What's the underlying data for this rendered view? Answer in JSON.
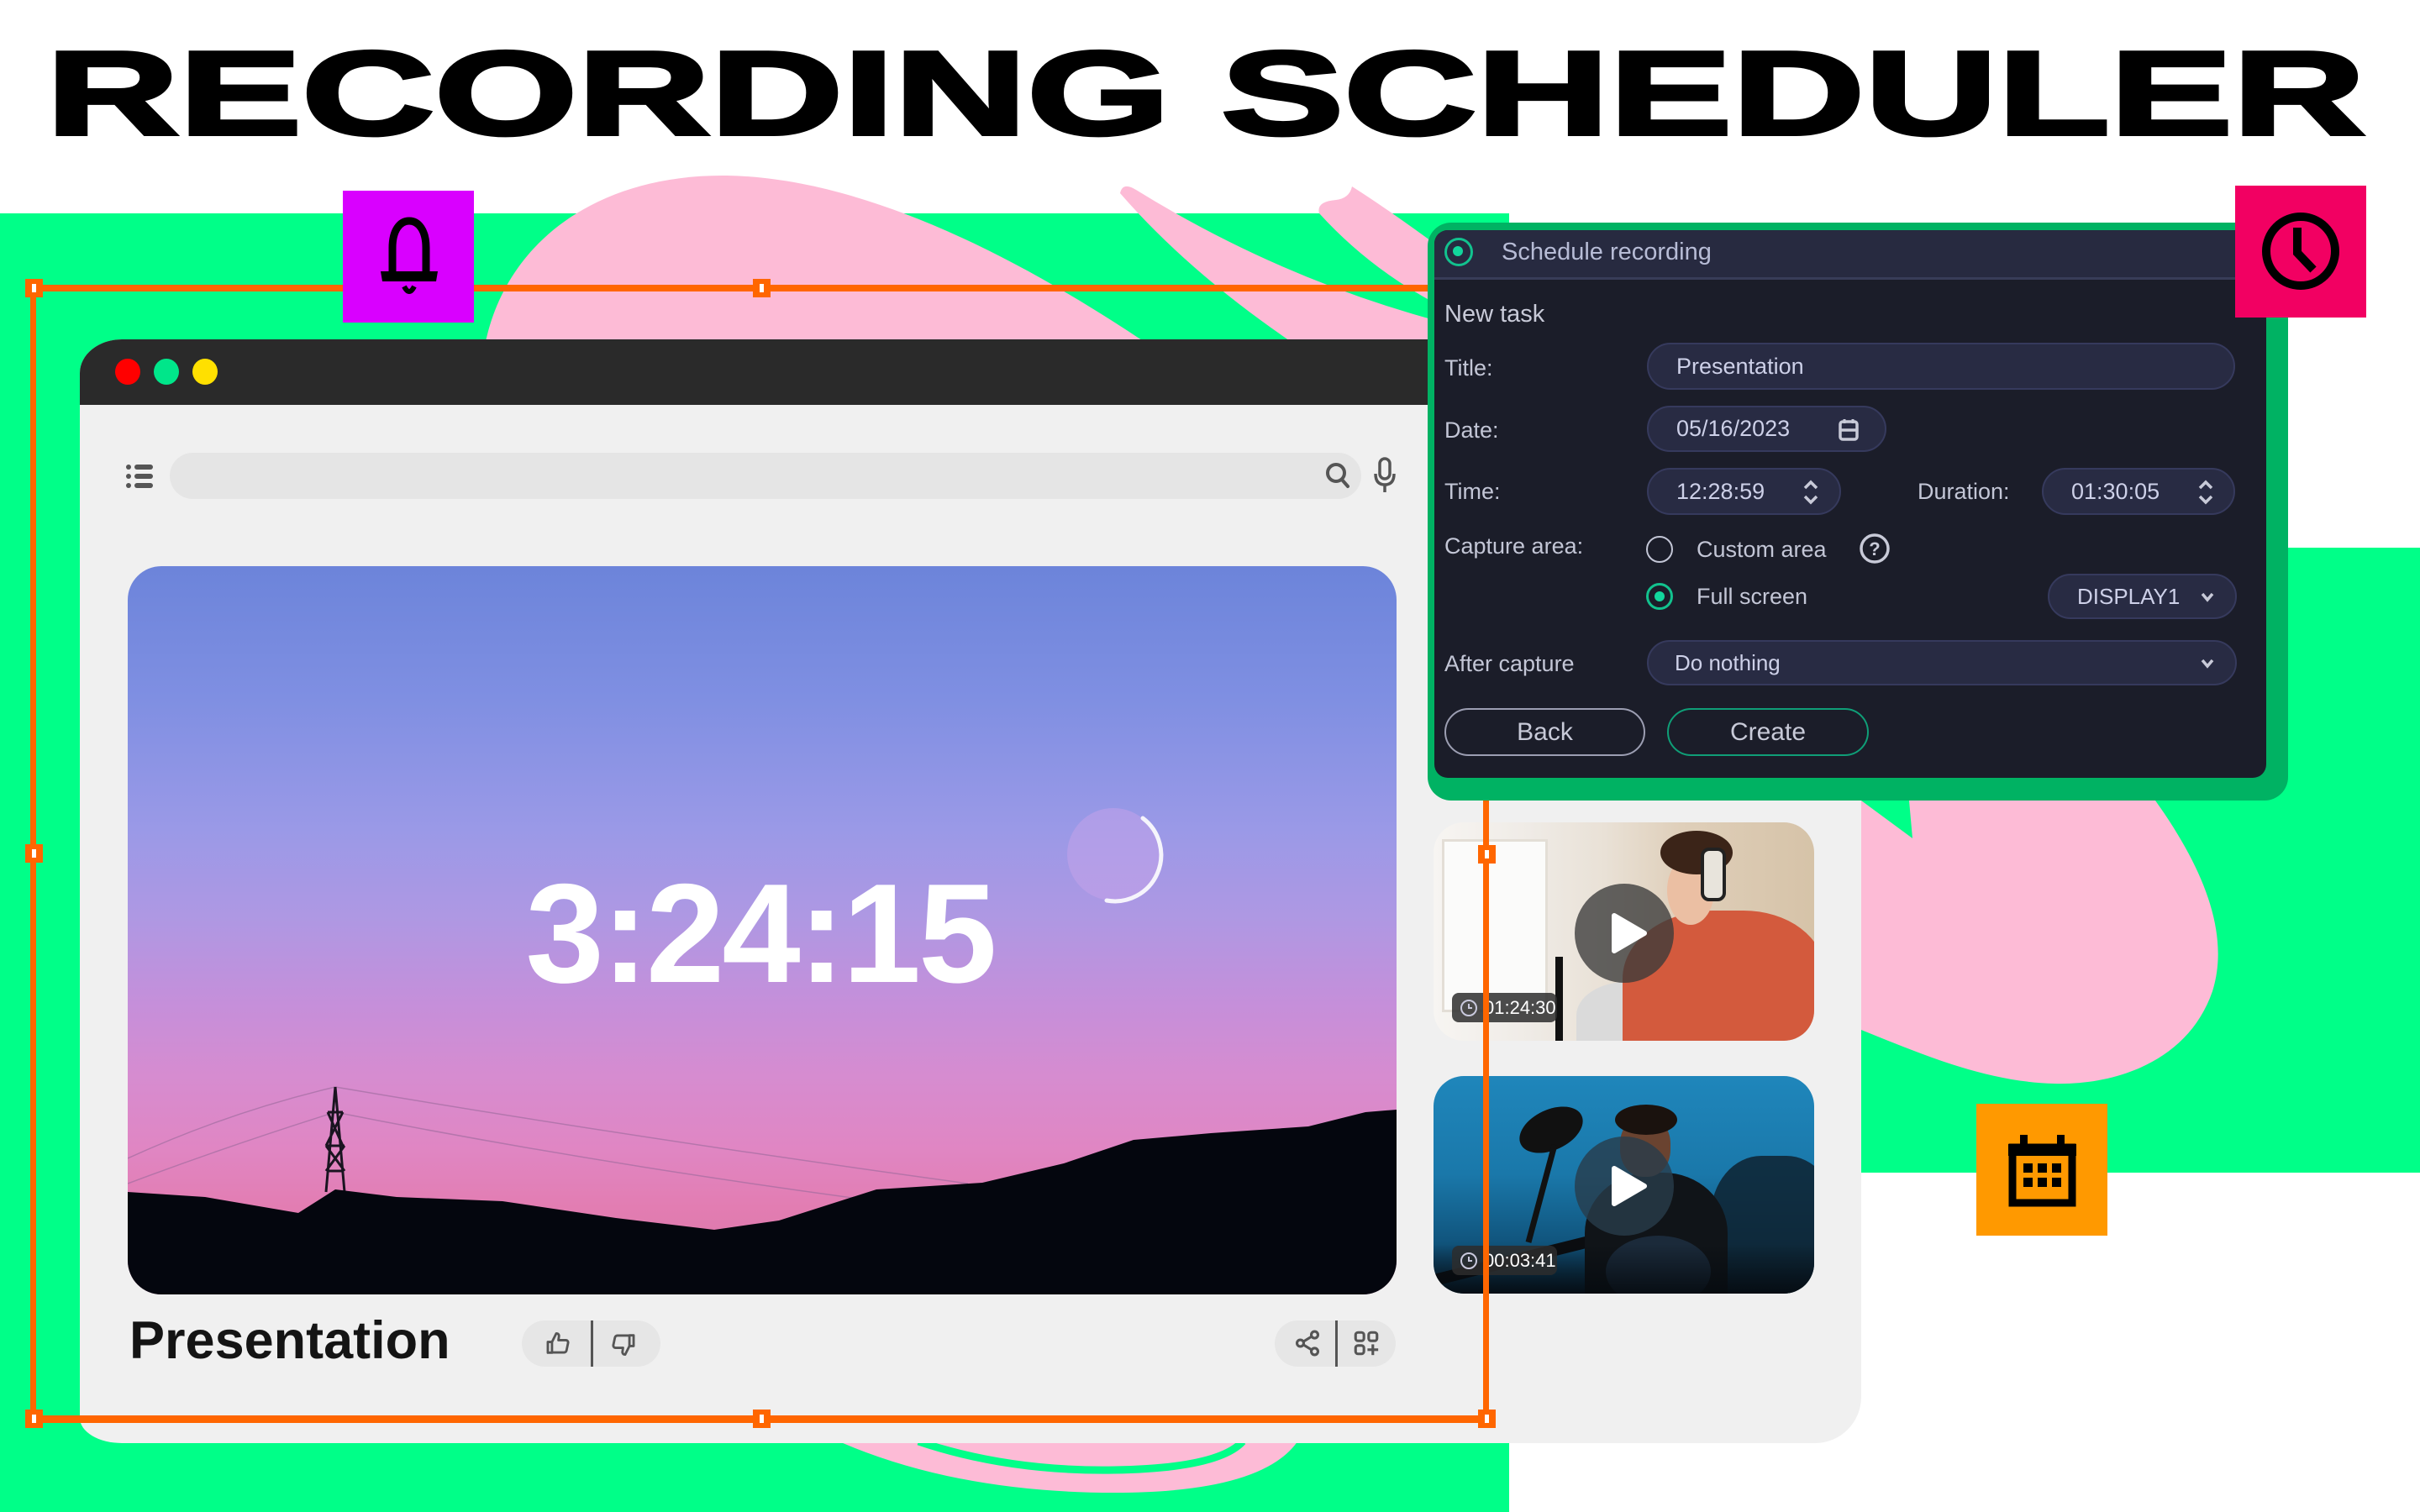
{
  "page": {
    "title": "RECORDING SCHEDULER"
  },
  "colors": {
    "background_green": "#00FF88",
    "blob_pink": "#FDBBD6",
    "selection_orange": "#FF6600",
    "bell_badge": "#D900FF",
    "clock_badge": "#F20062",
    "calendar_badge": "#FF9900",
    "dialog_frame": "#00B263",
    "dialog_accent": "#12C28E",
    "window_close": "#FF0000",
    "window_minimize": "#00E68A",
    "window_maximize": "#FFE000"
  },
  "badges": {
    "bell": {
      "icon": "bell-icon"
    },
    "clock": {
      "icon": "clock-icon"
    },
    "calendar": {
      "icon": "calendar-icon"
    }
  },
  "browser": {
    "window_controls": [
      "close",
      "minimize",
      "maximize"
    ],
    "toolbar": {
      "menu_icon": "list-icon",
      "search_value": "",
      "search_placeholder": "",
      "search_icon": "search-icon",
      "mic_icon": "microphone-icon"
    },
    "player": {
      "timer": "3:24:15",
      "title": "Presentation",
      "actions_left": [
        {
          "icon": "thumbs-up-icon"
        },
        {
          "icon": "thumbs-down-icon"
        }
      ],
      "actions_right": [
        {
          "icon": "share-icon"
        },
        {
          "icon": "add-to-collection-icon"
        }
      ]
    },
    "thumbnails": [
      {
        "duration": "01:24:30",
        "icon": "play-icon"
      },
      {
        "duration": "00:03:41",
        "icon": "play-icon"
      }
    ]
  },
  "dialog": {
    "title": "Schedule recording",
    "section": "New task",
    "fields": {
      "title": {
        "label": "Title:",
        "value": "Presentation"
      },
      "date": {
        "label": "Date:",
        "value": "05/16/2023"
      },
      "time": {
        "label": "Time:",
        "value": "12:28:59"
      },
      "duration": {
        "label": "Duration:",
        "value": "01:30:05"
      },
      "capture_area": {
        "label": "Capture area:",
        "options": [
          {
            "label": "Custom area",
            "selected": false
          },
          {
            "label": "Full screen",
            "selected": true
          }
        ],
        "display": "DISPLAY1"
      },
      "after_capture": {
        "label": "After capture",
        "value": "Do nothing"
      }
    },
    "buttons": {
      "back": "Back",
      "create": "Create"
    }
  }
}
